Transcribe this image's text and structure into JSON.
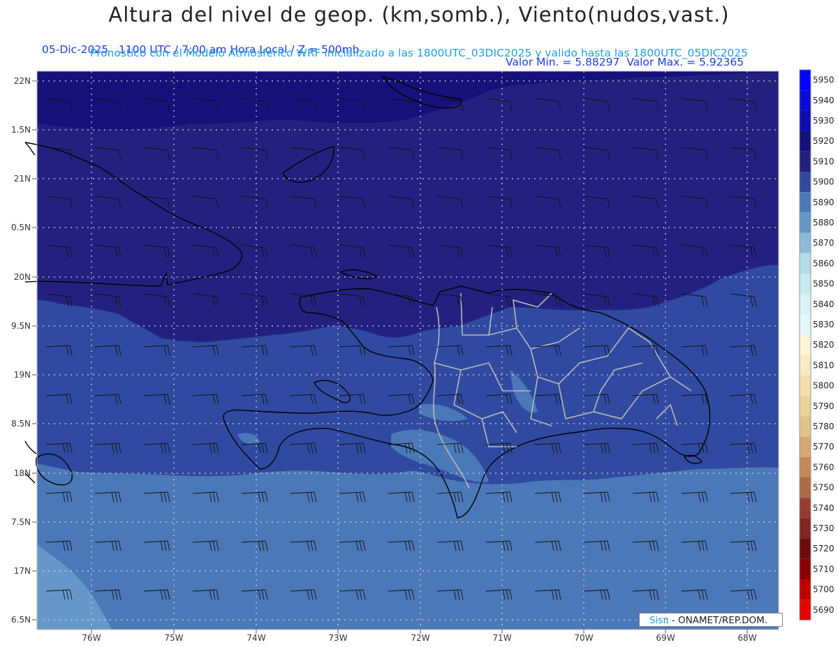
{
  "header": {
    "title": "Altura del nivel de geop. (km,somb.), Viento(nudos,vast.)",
    "date_time": "05-Dic-2025   1100 UTC / 7:00 am Hora Local / Z = 500mb",
    "min_max": "Valor Min. = 5.88297  Valor Max. = 5.92365",
    "model_info": "Pronostico con el Modelo Atmosferico WRF inicializado a las 1800UTC_03DIC2025 y valido hasta las  1800UTC_05DIC2025"
  },
  "axes": {
    "lat_labels": [
      "22N",
      "1.5N",
      "21N",
      "0.5N",
      "20N",
      "9.5N",
      "19N",
      "8.5N",
      "18N",
      "7.5N",
      "17N",
      "6.5N"
    ],
    "lon_labels": [
      "76W",
      "75W",
      "74W",
      "73W",
      "72W",
      "71W",
      "70W",
      "69W",
      "68W"
    ]
  },
  "colorbar": {
    "labels": [
      "5950",
      "5940",
      "5930",
      "5920",
      "5910",
      "5900",
      "5890",
      "5880",
      "5870",
      "5860",
      "5850",
      "5840",
      "5830",
      "5820",
      "5810",
      "5800",
      "5790",
      "5780",
      "5770",
      "5760",
      "5750",
      "5740",
      "5730",
      "5720",
      "5710",
      "5700",
      "5690"
    ],
    "colors": [
      "#0000ff",
      "#0a0ad8",
      "#0c0cb0",
      "#15107a",
      "#23217f",
      "#2f4aa0",
      "#4b78b8",
      "#6598c8",
      "#8cbad8",
      "#b2dde8",
      "#c4ecf2",
      "#d7f2f6",
      "#e2f8fa",
      "#fdf4d6",
      "#f9eac0",
      "#f3deac",
      "#ebd19a",
      "#e2c28a",
      "#d4a870",
      "#c28a58",
      "#ae6a44",
      "#993c30",
      "#822420",
      "#6e0c0c",
      "#8c0000",
      "#c00000",
      "#e60000"
    ]
  },
  "credit": {
    "logo": "Sisπ",
    "text": "- ONAMET/REP.DOM."
  }
}
